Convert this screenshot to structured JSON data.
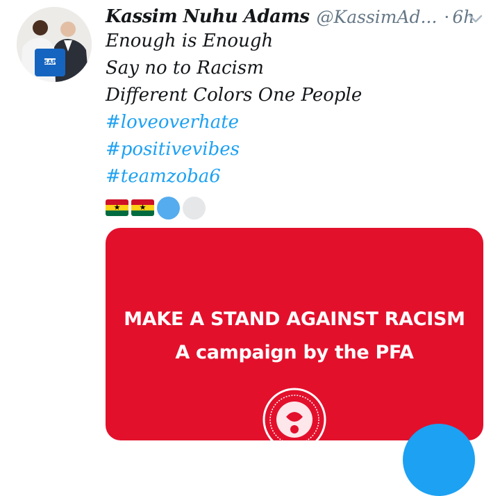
{
  "tweet": {
    "author_name": "Kassim Nuhu Adams",
    "handle": "@KassimAd...",
    "separator": "·",
    "time": "6h",
    "lines": [
      "Enough is Enough",
      "Say no to Racism",
      "Different Colors One People"
    ],
    "hashtags": [
      "#loveoverhate",
      "#positivevibes",
      "#teamzoba6"
    ],
    "emojis": [
      "ghana-flag",
      "ghana-flag",
      "blue-circle",
      "white-circle"
    ],
    "avatar_jersey_text": "SAP"
  },
  "media": {
    "title": "MAKE A STAND AGAINST RACISM",
    "subtitle": "A campaign by the PFA"
  },
  "colors": {
    "hashtag": "#1da1f2",
    "media_background": "#e3102c",
    "muted_text": "#657786",
    "fab": "#1da1f2"
  },
  "icons": [
    "chevron-down-icon",
    "pfa-crest-icon",
    "compose-fab"
  ]
}
